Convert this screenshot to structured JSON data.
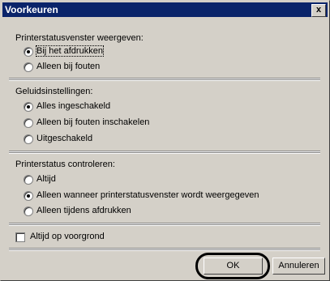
{
  "dialog": {
    "title": "Voorkeuren",
    "close_label": "x"
  },
  "printer_status_window": {
    "label": "Printerstatusvenster weergeven:",
    "options": [
      {
        "label": "Bij het afdrukken",
        "checked": true
      },
      {
        "label": "Alleen bij fouten",
        "checked": false
      }
    ]
  },
  "sound_settings": {
    "label": "Geluidsinstellingen:",
    "options": [
      {
        "label": "Alles ingeschakeld",
        "checked": true
      },
      {
        "label": "Alleen bij fouten inschakelen",
        "checked": false
      },
      {
        "label": "Uitgeschakeld",
        "checked": false
      }
    ]
  },
  "printer_status_check": {
    "label": "Printerstatus controleren:",
    "options": [
      {
        "label": "Altijd",
        "checked": false
      },
      {
        "label": "Alleen wanneer printerstatusvenster wordt weergegeven",
        "checked": true
      },
      {
        "label": "Alleen tijdens afdrukken",
        "checked": false
      }
    ]
  },
  "always_on_top": {
    "label": "Altijd op voorgrond",
    "checked": false
  },
  "buttons": {
    "ok": "OK",
    "cancel": "Annuleren"
  }
}
